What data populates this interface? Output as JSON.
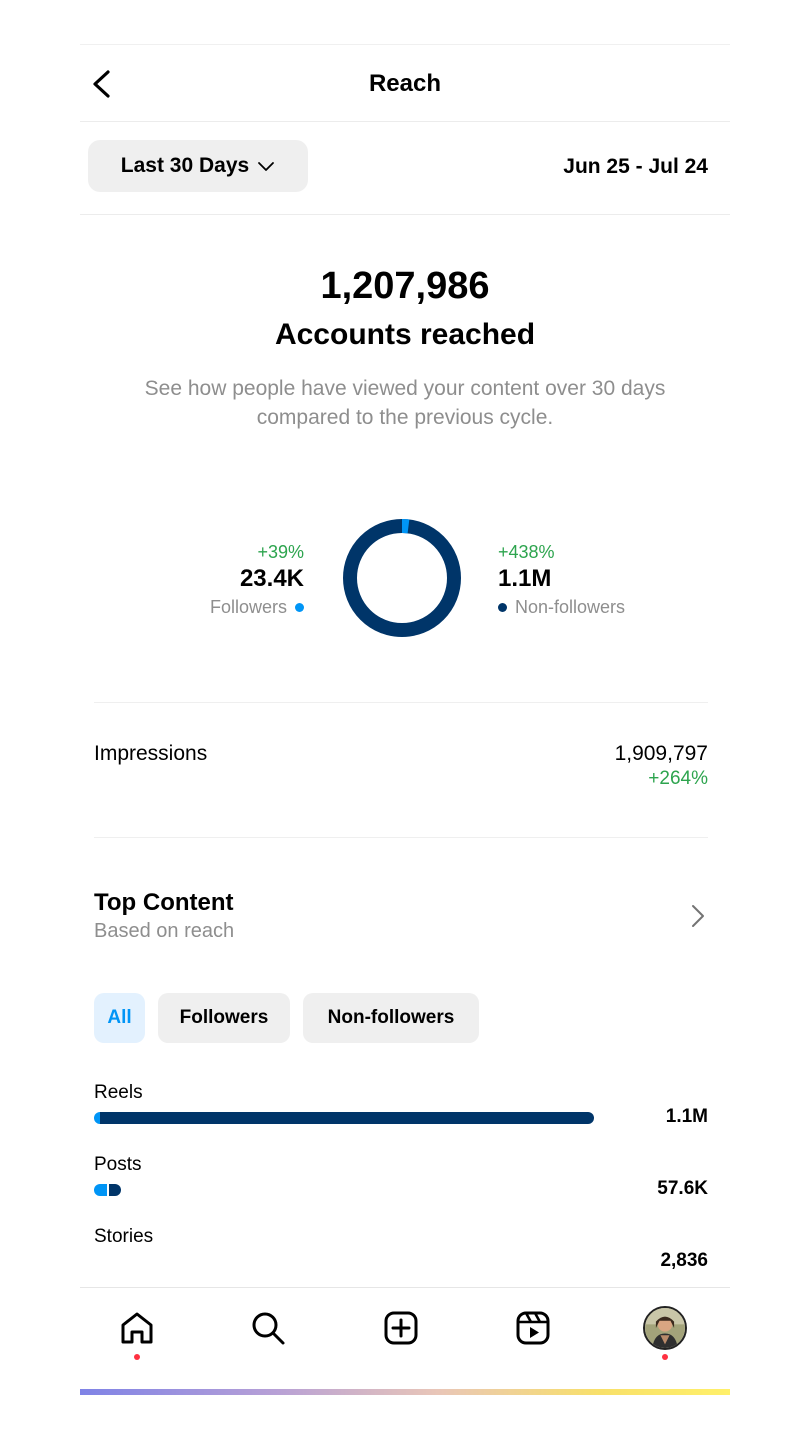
{
  "header": {
    "title": "Reach"
  },
  "filter": {
    "range_label": "Last 30 Days",
    "date_range": "Jun 25 - Jul 24"
  },
  "summary": {
    "total": "1,207,986",
    "label": "Accounts reached",
    "description": "See how people have viewed your content over 30 days compared to the previous cycle."
  },
  "breakdown": {
    "followers": {
      "change": "+39%",
      "value": "23.4K",
      "label": "Followers",
      "share": 0.02
    },
    "non_followers": {
      "change": "+438%",
      "value": "1.1M",
      "label": "Non-followers",
      "share": 0.98
    }
  },
  "impressions": {
    "label": "Impressions",
    "value": "1,909,797",
    "change": "+264%"
  },
  "top_content": {
    "title": "Top Content",
    "subtitle": "Based on reach",
    "filters": [
      "All",
      "Followers",
      "Non-followers"
    ],
    "selected_filter": "All",
    "items": [
      {
        "label": "Reels",
        "value": "1.1M",
        "followers_fraction": 0.011,
        "non_followers_fraction": 0.989
      },
      {
        "label": "Posts",
        "value": "57.6K",
        "followers_fraction": 0.51,
        "non_followers_fraction": 0.49
      },
      {
        "label": "Stories",
        "value": "2,836",
        "followers_fraction": 0,
        "non_followers_fraction": 0
      }
    ]
  },
  "colors": {
    "followers": "#0095f6",
    "non_followers": "#003569",
    "positive": "#2da44e",
    "muted": "#8e8e8e",
    "notification": "#ff3040"
  },
  "nav": {
    "items": [
      "home-icon",
      "search-icon",
      "create-icon",
      "reels-icon",
      "profile-avatar"
    ],
    "notifications": [
      "home",
      "profile"
    ]
  }
}
